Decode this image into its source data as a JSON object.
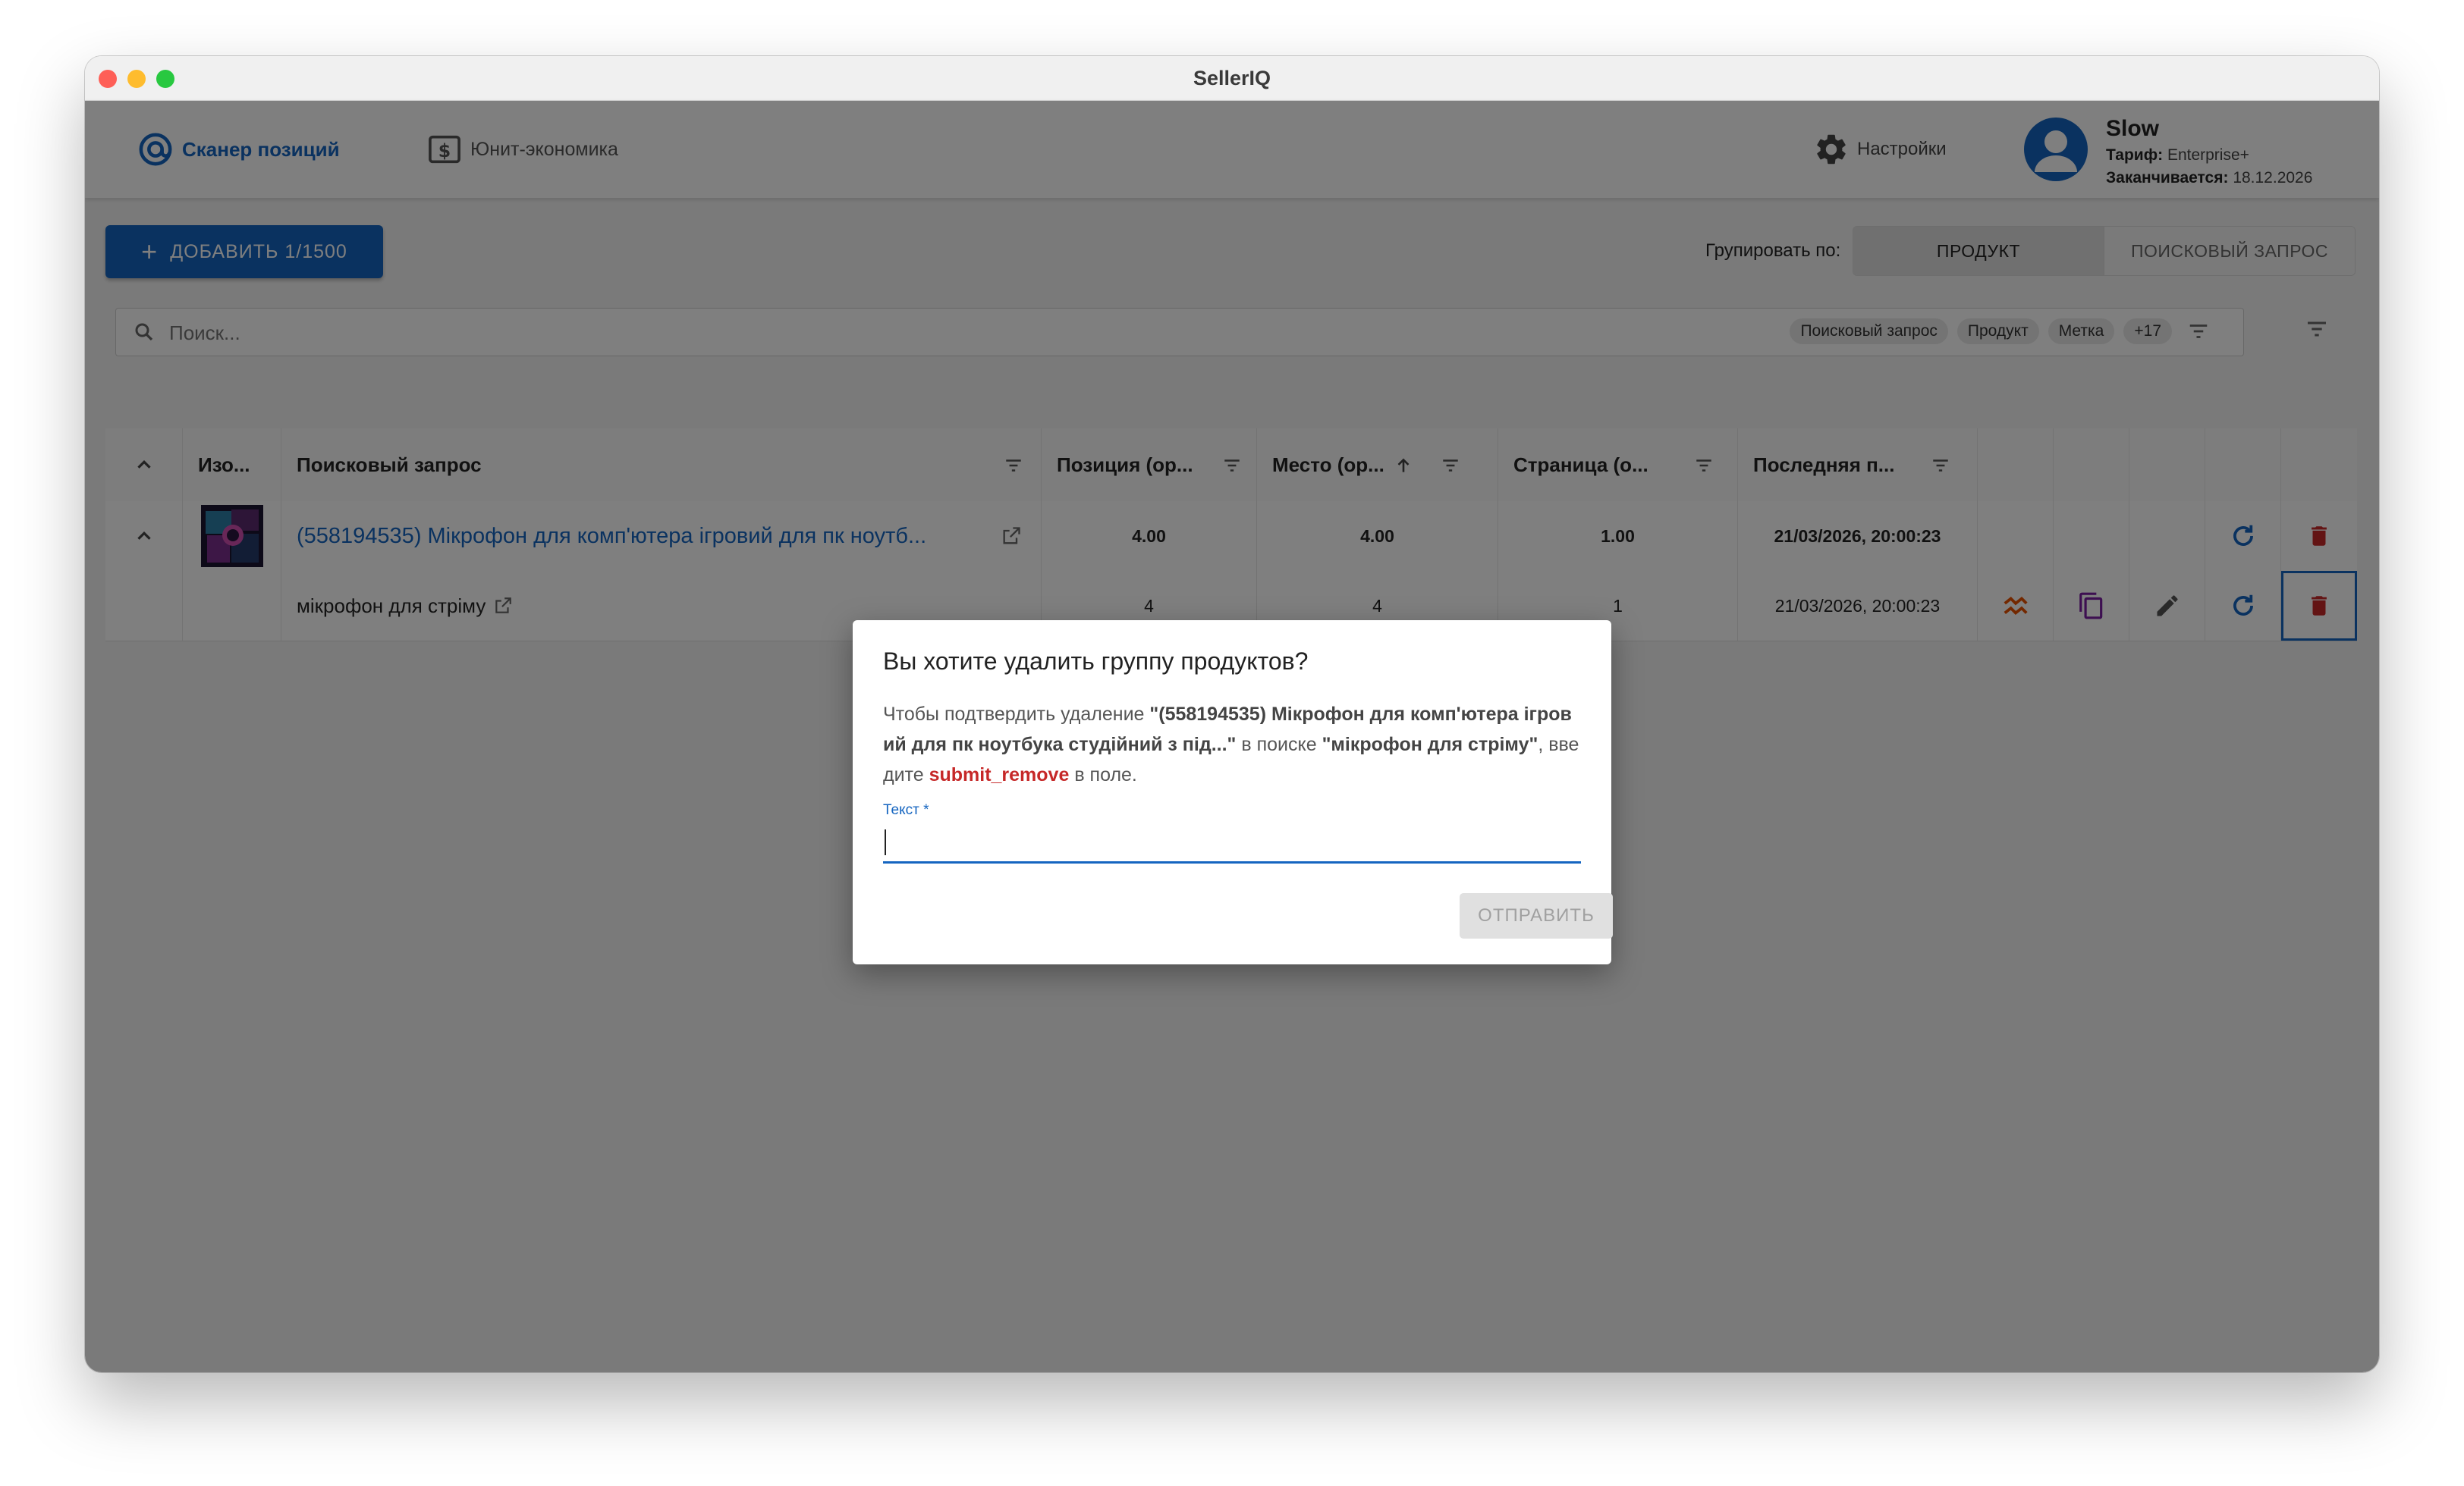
{
  "window": {
    "title": "SellerIQ"
  },
  "nav": {
    "tabs": [
      {
        "label": "Сканер позиций",
        "icon": "at-sign-icon",
        "active": true
      },
      {
        "label": "Юнит-экономика",
        "icon": "dollar-box-icon",
        "active": false
      }
    ],
    "settings_label": "Настройки",
    "user": {
      "name": "Slow",
      "plan_label": "Тариф:",
      "plan_value": "Enterprise+",
      "expires_label": "Заканчивается:",
      "expires_value": "18.12.2026"
    }
  },
  "toolbar": {
    "add_label": "ДОБАВИТЬ 1/1500",
    "group_by_label": "Групировать по:",
    "group_options": [
      "ПРОДУКТ",
      "ПОИСКОВЫЙ ЗАПРОС"
    ],
    "group_selected": "ПРОДУКТ"
  },
  "search": {
    "placeholder": "Поиск...",
    "chips": [
      "Поисковый запрос",
      "Продукт",
      "Метка",
      "+17"
    ]
  },
  "table": {
    "headers": [
      "Изо...",
      "Поисковый запрос",
      "Позиция (ор...",
      "Место (ор...",
      "Страница (о...",
      "Последняя п..."
    ],
    "group_row": {
      "title": "(558194535) Мікрофон для комп'ютера ігровий для пк ноутб...",
      "position": "4.00",
      "place": "4.00",
      "page": "1.00",
      "last": "21/03/2026, 20:00:23"
    },
    "rows": [
      {
        "query": "мікрофон для стріму",
        "position": "4",
        "place": "4",
        "page": "1",
        "last": "21/03/2026, 20:00:23"
      }
    ]
  },
  "dialog": {
    "title": "Вы хотите удалить группу продуктов?",
    "text_prefix": "Чтобы подтвердить удаление ",
    "product_name": "\"(558194535) Мікрофон для комп'ютера ігровий для пк ноутбука студійний з під...\"",
    "text_middle": " в поиске ",
    "query_name": "\"мікрофон для стріму\"",
    "text_enter": ", введите ",
    "keyword": "submit_remove",
    "text_suffix": " в поле.",
    "field_label": "Текст *",
    "field_value": "",
    "submit_label": "ОТПРАВИТЬ"
  },
  "colors": {
    "accent": "#1565c0",
    "danger": "#c62828",
    "compare": "#e65100",
    "copy": "#7b1fa2"
  }
}
